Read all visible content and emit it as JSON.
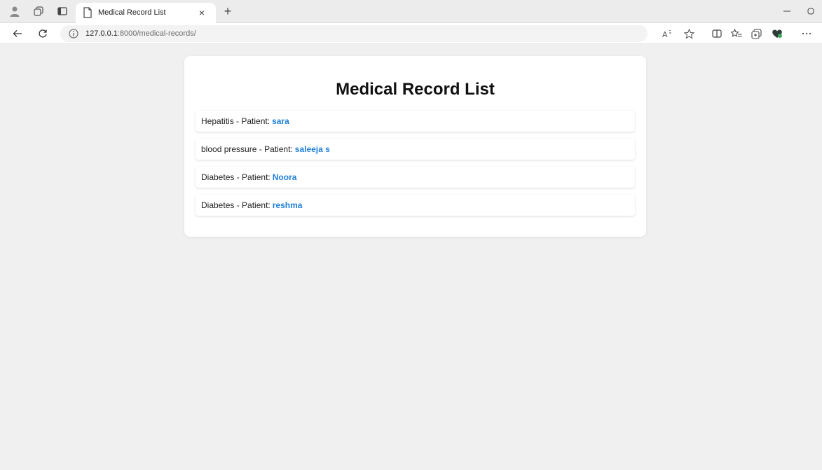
{
  "browser": {
    "tab_title": "Medical Record List",
    "tab_close": "×",
    "new_tab": "+",
    "url_host": "127.0.0.1",
    "url_path": ":8000/medical-records/"
  },
  "page": {
    "title": "Medical Record List",
    "patient_label": "- Patient:",
    "records": [
      {
        "condition": "Hepatitis",
        "patient": "sara"
      },
      {
        "condition": "blood pressure",
        "patient": "saleeja s"
      },
      {
        "condition": "Diabetes",
        "patient": "Noora"
      },
      {
        "condition": "Diabetes",
        "patient": "reshma"
      }
    ]
  },
  "colors": {
    "page_background": "#f0f0f0",
    "card_background": "#ffffff",
    "patient_link": "#1e7fd9"
  }
}
